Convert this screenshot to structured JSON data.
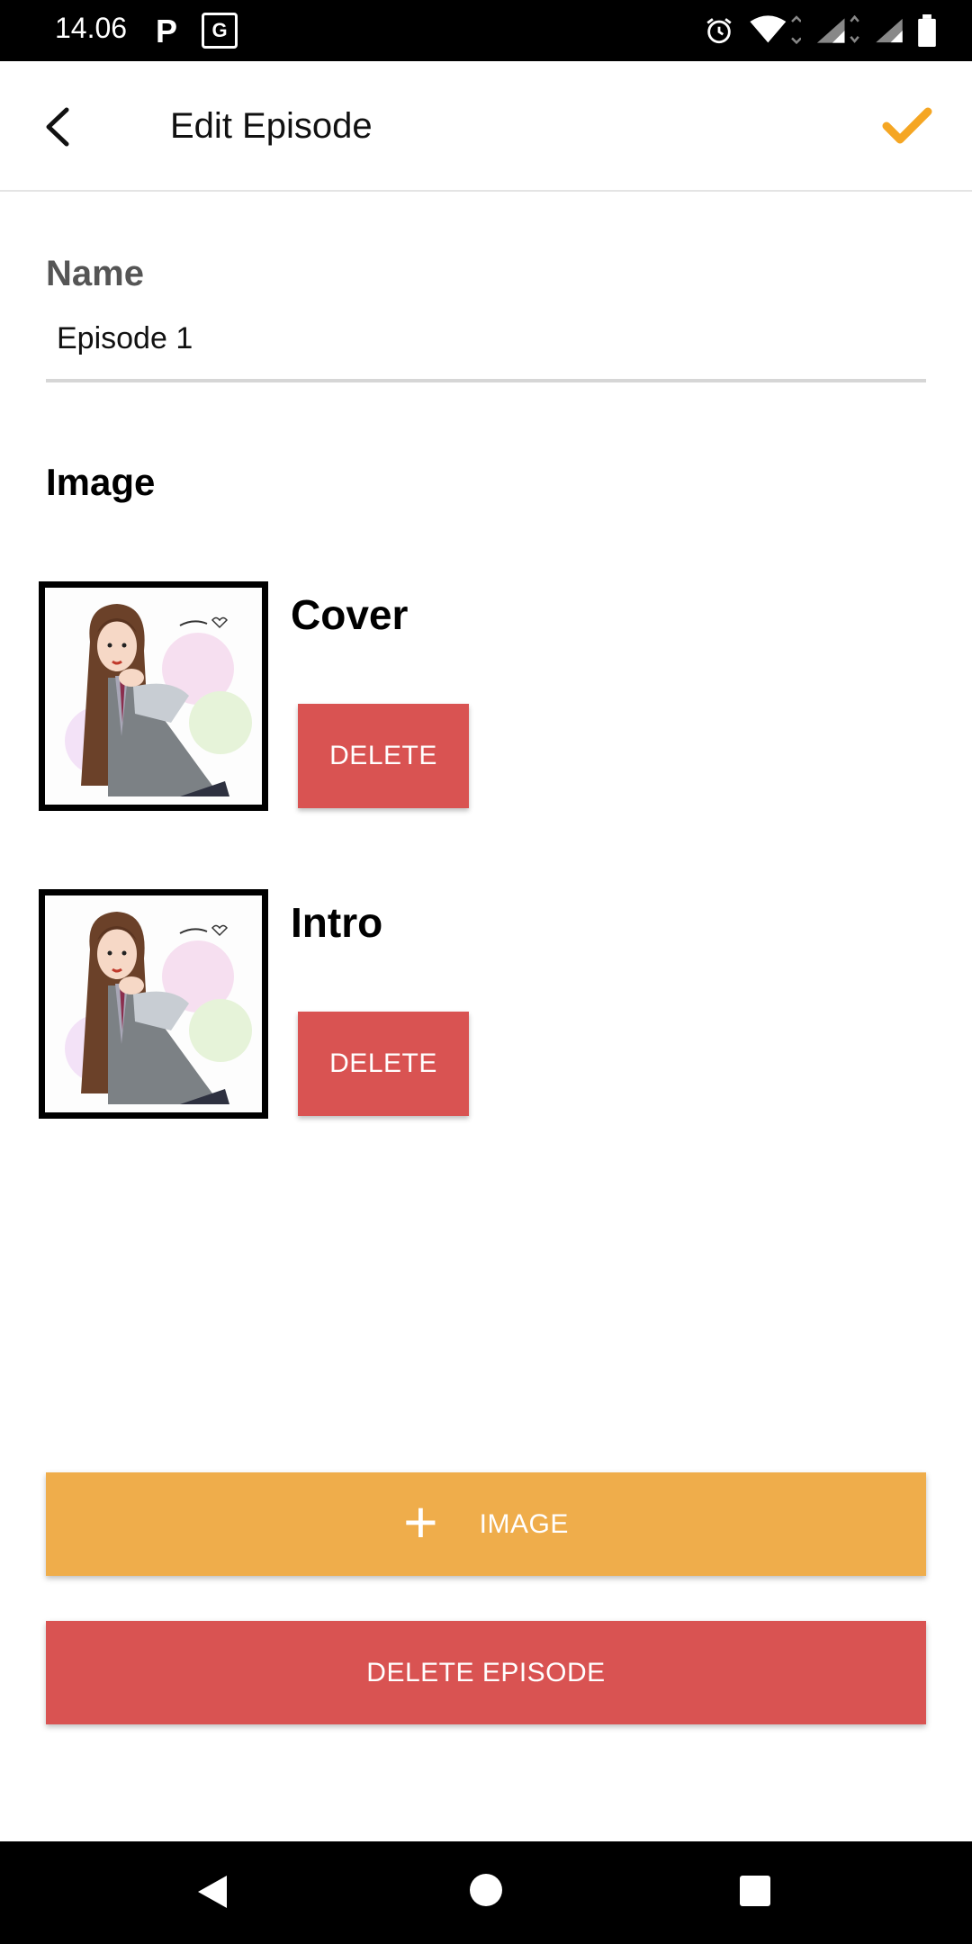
{
  "status_bar": {
    "time": "14.06",
    "icons": [
      "parking-icon",
      "translate-icon",
      "alarm-icon",
      "wifi-icon",
      "signal-icon",
      "signal-icon",
      "battery-icon"
    ],
    "p_glyph": "P",
    "gt_glyph": "G"
  },
  "app_bar": {
    "title": "Edit Episode",
    "back_icon": "arrow-back-icon",
    "confirm_icon": "check-icon",
    "accent": "#F5A623"
  },
  "name_field": {
    "label": "Name",
    "value": "Episode 1"
  },
  "images_section": {
    "title": "Image",
    "items": [
      {
        "name": "Cover",
        "delete_label": "DELETE"
      },
      {
        "name": "Intro",
        "delete_label": "DELETE"
      }
    ]
  },
  "actions": {
    "add_image_label": "IMAGE",
    "add_image_icon": "plus-icon",
    "add_image_color": "#EFAD4B",
    "delete_episode_label": "DELETE EPISODE",
    "delete_color": "#D95352"
  },
  "nav_bar": {
    "icons": [
      "nav-back-icon",
      "nav-home-icon",
      "nav-recents-icon"
    ]
  }
}
